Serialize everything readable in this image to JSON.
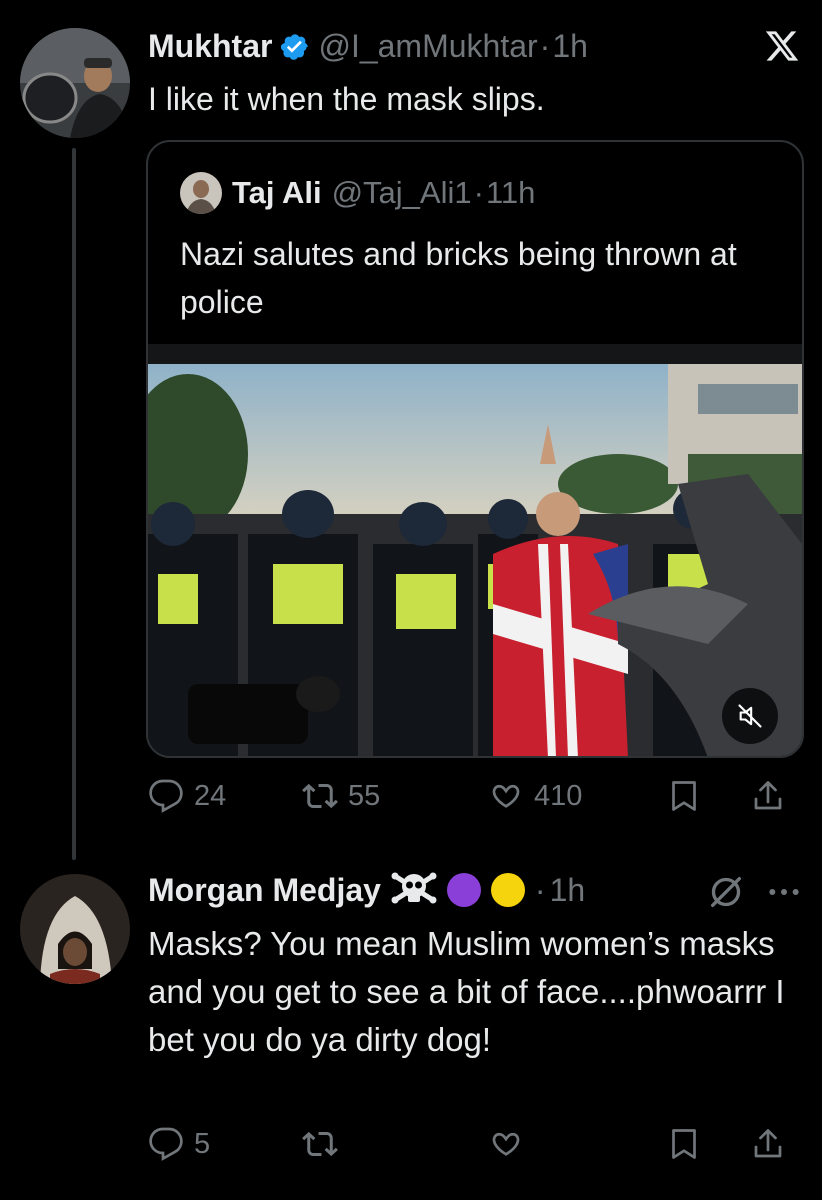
{
  "colors": {
    "background": "#000000",
    "text": "#e7e9ea",
    "muted": "#71767b",
    "border": "#2f3336",
    "verified": "#1d9bf0",
    "purple_dot": "#8b3fd9",
    "yellow_dot": "#f5d40d"
  },
  "tweet1": {
    "author_name": "Mukhtar",
    "handle": "@I_amMukhtar",
    "separator": "·",
    "time": "1h",
    "text": "I like it when the mask slips.",
    "verified": true,
    "quote": {
      "author_name": "Taj Ali",
      "handle": "@Taj_Ali1",
      "separator": "·",
      "time": "11h",
      "text": "Nazi salutes and bricks being thrown at police",
      "media_icon": "mute-icon"
    },
    "actions": {
      "replies": "24",
      "reposts": "55",
      "likes": "410"
    }
  },
  "tweet2": {
    "author_name": "Morgan Medjay",
    "separator": "·",
    "time": "1h",
    "text": "Masks? You mean Muslim women’s masks and you get to see a bit of face....phwoarrr I bet you do ya dirty dog!",
    "name_emojis": [
      "skull-crossbones-icon",
      "purple-circle-icon",
      "yellow-circle-icon"
    ],
    "actions": {
      "replies": "5"
    }
  },
  "icons": {
    "app_logo": "x-logo-icon",
    "reply": "reply-icon",
    "repost": "repost-icon",
    "like": "heart-icon",
    "bookmark": "bookmark-icon",
    "share": "share-icon",
    "grok": "grok-icon",
    "more": "more-icon"
  }
}
